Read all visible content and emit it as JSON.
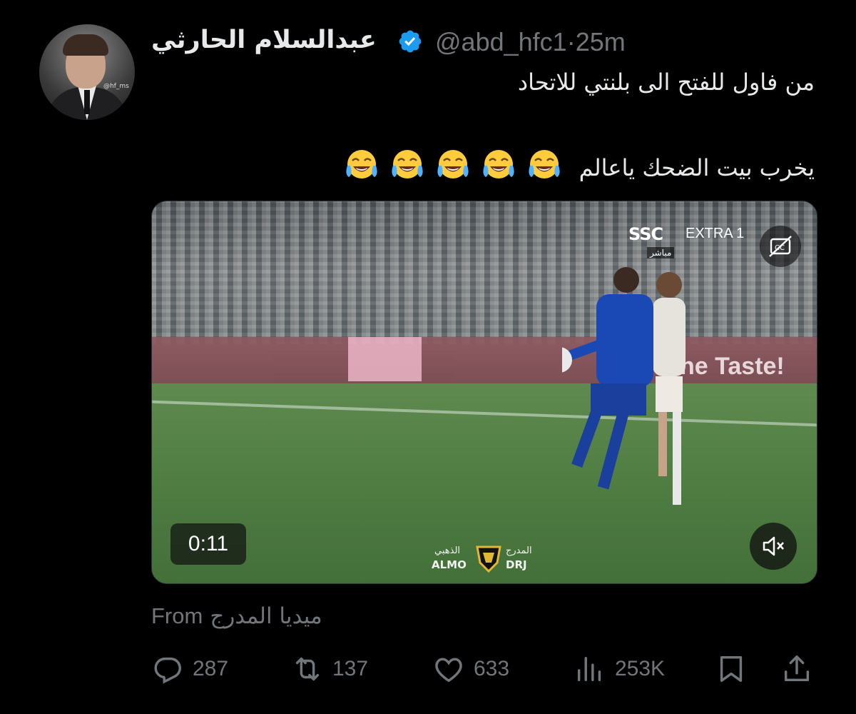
{
  "tweet": {
    "author": {
      "display_name": "عبدالسلام الحارثي",
      "handle": "@abd_hfc1",
      "separator": "·",
      "time": "25m",
      "verified": true,
      "avatar_icon": "profile-photo",
      "avatar_watermark": "@hf_ms"
    },
    "text": {
      "line1": "من فاول للفتح الى بلنتي للاتحاد",
      "line2": "يخرب بيت الضحك ياعالم",
      "emoji_count": 5,
      "emoji_icon": "face-with-tears-of-joy-emoji"
    },
    "media": {
      "type": "video",
      "duration": "0:11",
      "broadcaster": "SSC",
      "channel": "EXTRA 1",
      "live_tag": "مباشر",
      "board_text": "he Taste!",
      "watermark_left": "ALMO",
      "watermark_right": "DRJ",
      "watermark_left_ar": "الذهبي",
      "watermark_right_ar": "المدرج",
      "captions_icon": "closed-captions-off-icon",
      "mute_icon": "volume-muted-icon"
    },
    "from": {
      "label": "From",
      "source": "ميديا المدرج"
    },
    "actions": {
      "replies": "287",
      "reposts": "137",
      "likes": "633",
      "views": "253K"
    }
  },
  "colors": {
    "background": "#000000",
    "text_primary": "#e7e9ea",
    "text_secondary": "#71767b",
    "verified_blue": "#1d9bf0"
  }
}
